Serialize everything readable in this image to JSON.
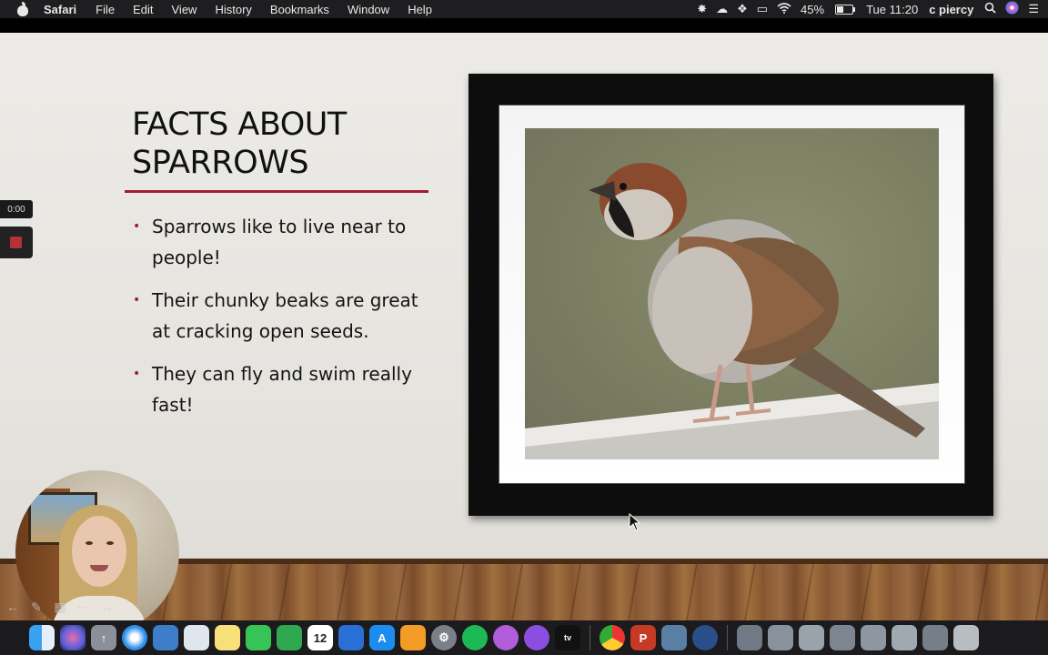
{
  "menubar": {
    "app_name": "Safari",
    "menus": [
      "File",
      "Edit",
      "View",
      "History",
      "Bookmarks",
      "Window",
      "Help"
    ],
    "battery_percent": "45%",
    "clock": "Tue 11:20",
    "user": "c piercy",
    "status_icons": [
      "brightness-icon",
      "cloud-icon",
      "dropbox-icon",
      "airplay-icon",
      "wifi-icon",
      "battery-icon",
      "search-icon",
      "siri-icon",
      "control-center-icon"
    ]
  },
  "slide": {
    "title_line1": "FACTS ABOUT",
    "title_line2": "SPARROWS",
    "bullets": [
      "Sparrows like to live near to people!",
      "Their chunky beaks are great at cracking open seeds.",
      "They can fly and swim really fast!"
    ],
    "accent_color": "#a11b35"
  },
  "recorder": {
    "timer": "0:00"
  },
  "dock": {
    "apps": [
      "finder",
      "siri",
      "launchpad",
      "safari",
      "preview",
      "photos",
      "notes",
      "messages",
      "numbers",
      "calendar",
      "keynote",
      "app-store",
      "pages",
      "system-preferences",
      "spotify",
      "podcasts-alt",
      "podcasts",
      "apple-tv",
      "chrome",
      "powerpoint",
      "preview-2",
      "screen-recorder"
    ],
    "calendar_day": "12"
  }
}
